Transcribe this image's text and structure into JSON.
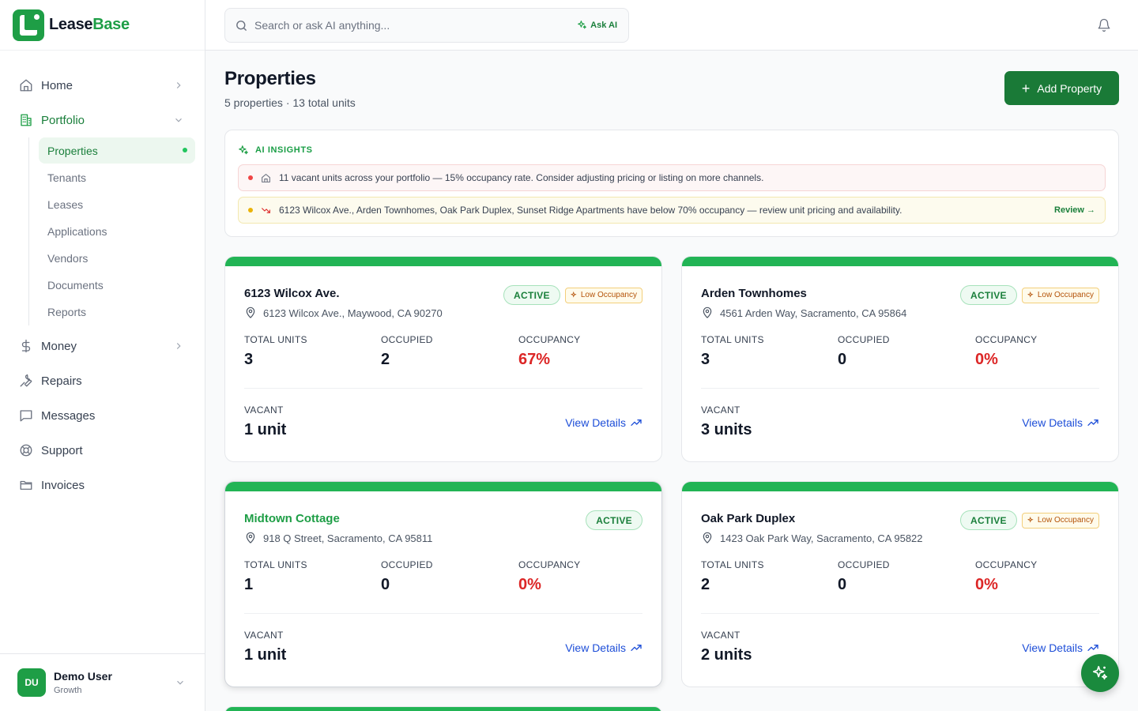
{
  "brand": {
    "name_part1": "Lease",
    "name_part2": "Base"
  },
  "sidebar": {
    "items": [
      {
        "label": "Home",
        "icon": "home-icon"
      },
      {
        "label": "Portfolio",
        "icon": "building-icon"
      },
      {
        "label": "Money",
        "icon": "dollar-icon"
      },
      {
        "label": "Repairs",
        "icon": "wrench-icon"
      },
      {
        "label": "Messages",
        "icon": "message-icon"
      },
      {
        "label": "Support",
        "icon": "lifebuoy-icon"
      },
      {
        "label": "Invoices",
        "icon": "folder-icon"
      }
    ],
    "portfolio_sub": [
      "Properties",
      "Tenants",
      "Leases",
      "Applications",
      "Vendors",
      "Documents",
      "Reports"
    ]
  },
  "user": {
    "initials": "DU",
    "name": "Demo User",
    "plan": "Growth"
  },
  "search": {
    "placeholder": "Search or ask AI anything...",
    "ask_label": "Ask AI"
  },
  "page": {
    "title": "Properties",
    "subtitle": "5 properties · 13 total units",
    "add_button": "Add Property"
  },
  "insights": {
    "heading": "AI INSIGHTS",
    "rows": [
      {
        "text": "11 vacant units across your portfolio — 15% occupancy rate. Consider adjusting pricing or listing on more channels.",
        "severity": "red"
      },
      {
        "text": "6123 Wilcox Ave., Arden Townhomes, Oak Park Duplex, Sunset Ridge Apartments have below 70% occupancy — review unit pricing and availability.",
        "severity": "yellow",
        "action": "Review →"
      }
    ]
  },
  "labels": {
    "active": "ACTIVE",
    "low_occupancy": "Low Occupancy",
    "total_units": "TOTAL UNITS",
    "occupied": "OCCUPIED",
    "occupancy": "OCCUPANCY",
    "vacant": "VACANT",
    "view_details": "View Details"
  },
  "properties": [
    {
      "name": "6123 Wilcox Ave.",
      "address": "6123 Wilcox Ave., Maywood, CA 90270",
      "total": "3",
      "occupied": "2",
      "occupancy": "67%",
      "vacant": "1 unit"
    },
    {
      "name": "Arden Townhomes",
      "address": "4561 Arden Way, Sacramento, CA 95864",
      "total": "3",
      "occupied": "0",
      "occupancy": "0%",
      "vacant": "3 units"
    },
    {
      "name": "Midtown Cottage",
      "address": "918 Q Street, Sacramento, CA 95811",
      "total": "1",
      "occupied": "0",
      "occupancy": "0%",
      "vacant": "1 unit"
    },
    {
      "name": "Oak Park Duplex",
      "address": "1423 Oak Park Way, Sacramento, CA 95822",
      "total": "2",
      "occupied": "0",
      "occupancy": "0%",
      "vacant": "2 units"
    }
  ],
  "colors": {
    "brand_green": "#1e9e46",
    "danger_red": "#dc2626",
    "link_blue": "#1d4ed8"
  }
}
